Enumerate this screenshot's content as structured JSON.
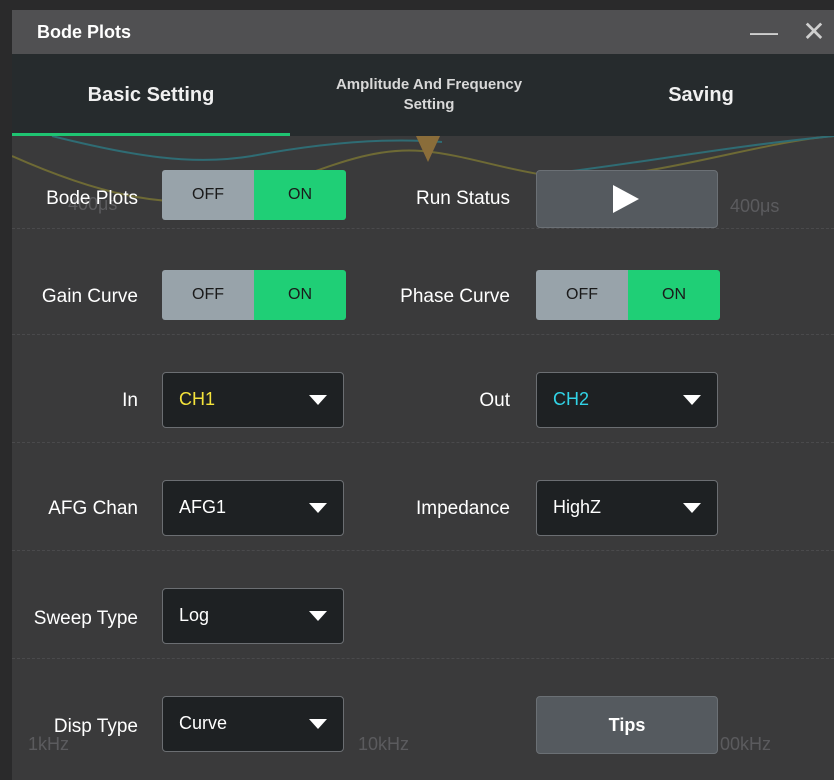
{
  "window": {
    "title": "Bode Plots",
    "minimize_glyph": "—",
    "close_glyph": "✕"
  },
  "tabs": [
    {
      "label": "Basic Setting",
      "active": true
    },
    {
      "label": "Amplitude And Frequency\nSetting",
      "active": false
    },
    {
      "label": "Saving",
      "active": false
    }
  ],
  "background": {
    "time_labels": [
      "400μs",
      "400μs"
    ],
    "freq_labels": [
      "1kHz",
      "10kHz",
      "00kHz"
    ]
  },
  "form": {
    "bode_plots": {
      "label": "Bode Plots",
      "off": "OFF",
      "on": "ON",
      "value": "ON"
    },
    "run_status": {
      "label": "Run Status",
      "icon": "play-icon"
    },
    "gain_curve": {
      "label": "Gain Curve",
      "off": "OFF",
      "on": "ON",
      "value": "ON"
    },
    "phase_curve": {
      "label": "Phase Curve",
      "off": "OFF",
      "on": "ON",
      "value": "ON"
    },
    "in": {
      "label": "In",
      "value": "CH1",
      "color": "#f4e33b"
    },
    "out": {
      "label": "Out",
      "value": "CH2",
      "color": "#31d3e6"
    },
    "afg_chan": {
      "label": "AFG Chan",
      "value": "AFG1"
    },
    "impedance": {
      "label": "Impedance",
      "value": "HighZ"
    },
    "sweep_type": {
      "label": "Sweep Type",
      "value": "Log"
    },
    "disp_type": {
      "label": "Disp Type",
      "value": "Curve"
    },
    "tips": {
      "label": "Tips"
    }
  },
  "colors": {
    "accent": "#1fcf76",
    "toggle_off": "#98a3aa",
    "ch1": "#f4e33b",
    "ch2": "#31d3e6"
  }
}
